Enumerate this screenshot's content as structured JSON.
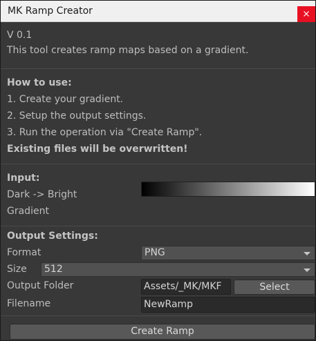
{
  "window": {
    "title": "MK Ramp Creator",
    "close_glyph": "×"
  },
  "intro": {
    "version": "V 0.1",
    "description": "This tool creates ramp maps based on a gradient."
  },
  "how_to": {
    "heading": "How to use:",
    "steps": [
      "1. Create your gradient.",
      "2. Setup the output settings.",
      "3. Run the operation via \"Create Ramp\"."
    ],
    "warning": "Existing files will be overwritten!"
  },
  "input": {
    "heading": "Input:",
    "direction": "Dark -> Bright",
    "gradient_label": "Gradient",
    "gradient_stops": [
      "#000000",
      "#ffffff"
    ]
  },
  "output": {
    "heading": "Output Settings:",
    "format_label": "Format",
    "format_value": "PNG",
    "size_label": "Size",
    "size_value": "512",
    "folder_label": "Output Folder",
    "folder_value": "Assets/_MK/MKF",
    "select_label": "Select",
    "filename_label": "Filename",
    "filename_value": "NewRamp"
  },
  "actions": {
    "create_label": "Create Ramp"
  },
  "colors": {
    "panel_bg": "#383838",
    "close_red": "#e81123",
    "text": "#bdbdbd"
  }
}
